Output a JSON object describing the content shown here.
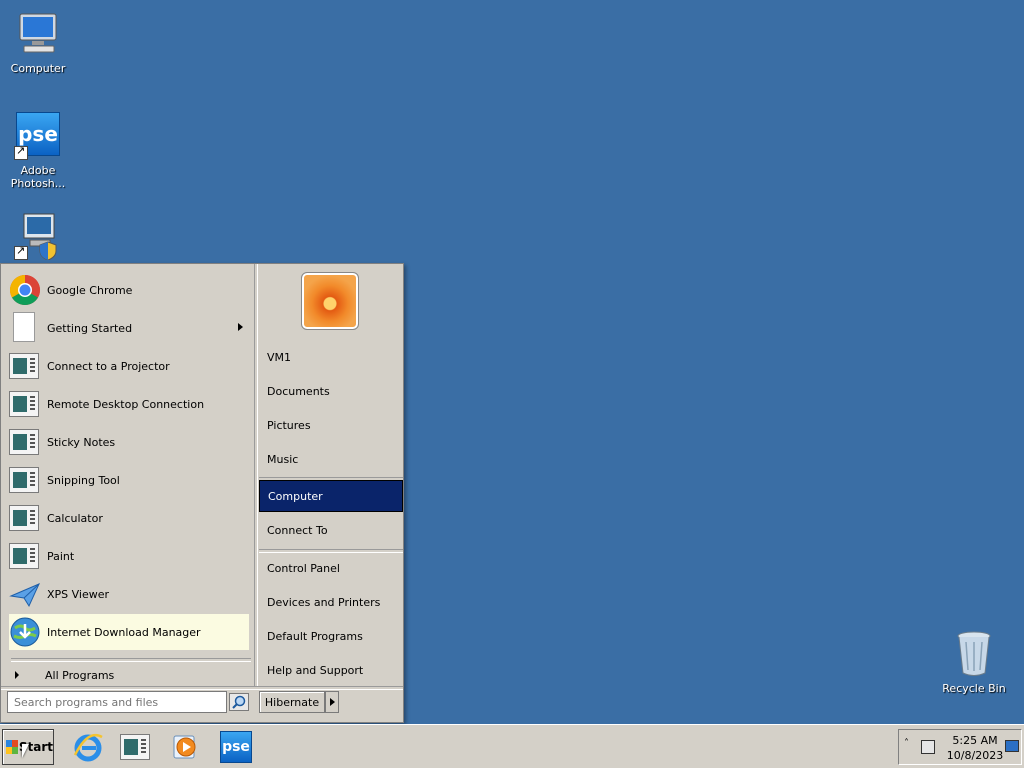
{
  "desktop": {
    "icons": [
      {
        "label": "Computer"
      },
      {
        "label": "Adobe Photosh..."
      },
      {
        "label": ""
      },
      {
        "label": "Recycle Bin"
      }
    ]
  },
  "start_menu": {
    "programs": [
      {
        "label": "Google Chrome"
      },
      {
        "label": "Getting Started"
      },
      {
        "label": "Connect to a Projector"
      },
      {
        "label": "Remote Desktop Connection"
      },
      {
        "label": "Sticky Notes"
      },
      {
        "label": "Snipping Tool"
      },
      {
        "label": "Calculator"
      },
      {
        "label": "Paint"
      },
      {
        "label": "XPS Viewer"
      },
      {
        "label": "Internet Download Manager"
      }
    ],
    "all_programs": "All Programs",
    "search_placeholder": "Search programs and files",
    "right_items": [
      {
        "label": "VM1"
      },
      {
        "label": "Documents"
      },
      {
        "label": "Pictures"
      },
      {
        "label": "Music"
      },
      {
        "label": "Computer"
      },
      {
        "label": "Connect To"
      },
      {
        "label": "Control Panel"
      },
      {
        "label": "Devices and Printers"
      },
      {
        "label": "Default Programs"
      },
      {
        "label": "Help and Support"
      }
    ],
    "power_button": "Hibernate"
  },
  "taskbar": {
    "start_label": "Start",
    "pse_label": "pse",
    "clock_time": "5:25 AM",
    "clock_date": "10/8/2023",
    "tray_arrow": "˄"
  },
  "colors": {
    "desktop": "#3a6ea5",
    "menu": "#d4d0c8",
    "selected": "#0a246a",
    "highlight": "#fbfbe1"
  }
}
